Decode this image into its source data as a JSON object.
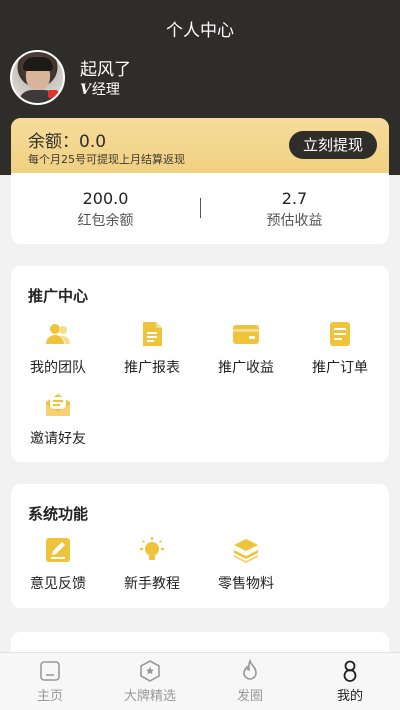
{
  "header": {
    "title": "个人中心",
    "username": "起风了",
    "level_prefix": "V",
    "level_label": "经理"
  },
  "balance": {
    "label": "余额：0.0",
    "note": "每个月25号可提现上月结算返现",
    "withdraw_label": "立刻提现",
    "stats": [
      {
        "value": "200.0",
        "label": "红包余额"
      },
      {
        "value": "2.7",
        "label": "预估收益"
      }
    ]
  },
  "promotion": {
    "title": "推广中心",
    "items": [
      {
        "label": "我的团队",
        "icon": "team-icon"
      },
      {
        "label": "推广报表",
        "icon": "report-icon"
      },
      {
        "label": "推广收益",
        "icon": "earnings-card-icon"
      },
      {
        "label": "推广订单",
        "icon": "order-icon"
      },
      {
        "label": "邀请好友",
        "icon": "invite-mail-icon"
      }
    ]
  },
  "system": {
    "title": "系统功能",
    "items": [
      {
        "label": "意见反馈",
        "icon": "feedback-edit-icon"
      },
      {
        "label": "新手教程",
        "icon": "tutorial-bulb-icon"
      },
      {
        "label": "零售物料",
        "icon": "materials-layers-icon"
      }
    ]
  },
  "nav": {
    "items": [
      {
        "label": "主页",
        "icon": "home-icon",
        "active": false
      },
      {
        "label": "大牌精选",
        "icon": "brand-star-icon",
        "active": false
      },
      {
        "label": "发圈",
        "icon": "flame-icon",
        "active": false
      },
      {
        "label": "我的",
        "icon": "profile-icon",
        "active": true
      }
    ]
  },
  "colors": {
    "dark": "#2f2d2a",
    "gold": "#f0c43a",
    "gold_card": "#f3d58c"
  }
}
